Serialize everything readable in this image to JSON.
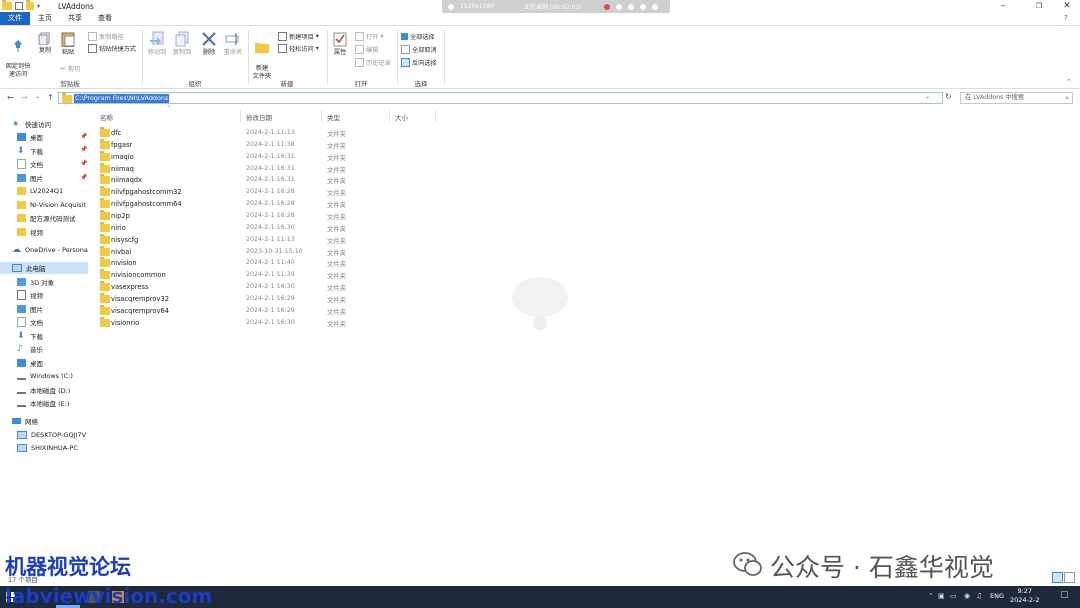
{
  "window": {
    "title": "LVAddons",
    "controls": [
      "minimize-icon",
      "maximize-icon",
      "close-icon"
    ],
    "help": "?"
  },
  "recorder": {
    "resolution": "1920x1080",
    "status": "正在录制 [00:02:03]"
  },
  "tabs": [
    {
      "label": "文件",
      "active": true
    },
    {
      "label": "主页"
    },
    {
      "label": "共享"
    },
    {
      "label": "查看"
    }
  ],
  "ribbon": {
    "clipboard": {
      "label": "剪贴板",
      "pin": "固定到快\n速访问",
      "copy": "复制",
      "paste": "粘贴",
      "copy_path": "复制路径",
      "paste_shortcut": "粘贴快捷方式",
      "cut": "剪切"
    },
    "organize": {
      "label": "组织",
      "move_to": "移动到",
      "copy_to": "复制到",
      "delete": "删除",
      "rename": "重命名"
    },
    "new": {
      "label": "新建",
      "new_folder": "新建\n文件夹",
      "new_item": "新建项目",
      "easy_access": "轻松访问"
    },
    "open": {
      "label": "打开",
      "properties": "属性",
      "open": "打开",
      "edit": "编辑",
      "history": "历史记录"
    },
    "select": {
      "label": "选择",
      "select_all": "全部选择",
      "select_none": "全部取消",
      "invert": "反向选择"
    }
  },
  "address": {
    "path": "C:\\Program Files\\NI\\LVAddons",
    "search_placeholder": "在 LVAddons 中搜索"
  },
  "sidebar": {
    "items": [
      {
        "label": "快速访问",
        "icon": "star-icon",
        "color": "#3a8de0"
      },
      {
        "label": "桌面",
        "icon": "desktop-icon",
        "color": "#3a8de0",
        "pinned": true
      },
      {
        "label": "下载",
        "icon": "download-icon",
        "color": "#3a8de0",
        "pinned": true
      },
      {
        "label": "文档",
        "icon": "document-icon",
        "color": "#9aa",
        "pinned": true
      },
      {
        "label": "图片",
        "icon": "picture-icon",
        "color": "#4a9ad8",
        "pinned": true
      },
      {
        "label": "LV2024Q1",
        "icon": "folder-icon",
        "color": "#f5c842"
      },
      {
        "label": "NI-Vision Acquisit",
        "icon": "folder-icon",
        "color": "#f5c842"
      },
      {
        "label": "配方源代码测试",
        "icon": "folder-icon",
        "color": "#f5c842"
      },
      {
        "label": "视频",
        "icon": "folder-icon",
        "color": "#f5c842"
      },
      {
        "label": "OneDrive - Persona",
        "icon": "cloud-icon",
        "color": "#2f7fd6"
      },
      {
        "label": "此电脑",
        "icon": "computer-icon",
        "color": "#3a8de0",
        "selected": true
      },
      {
        "label": "3D 对象",
        "icon": "cube-icon",
        "color": "#4aa0e0"
      },
      {
        "label": "视频",
        "icon": "video-icon",
        "color": "#777"
      },
      {
        "label": "图片",
        "icon": "picture-icon",
        "color": "#4a9ad8"
      },
      {
        "label": "文档",
        "icon": "document-icon",
        "color": "#9aa"
      },
      {
        "label": "下载",
        "icon": "download-icon",
        "color": "#3a8de0"
      },
      {
        "label": "音乐",
        "icon": "music-icon",
        "color": "#3a8de0"
      },
      {
        "label": "桌面",
        "icon": "desktop-icon",
        "color": "#3a8de0"
      },
      {
        "label": "Windows (C:)",
        "icon": "drive-icon",
        "color": "#777"
      },
      {
        "label": "本地磁盘 (D:)",
        "icon": "drive-icon",
        "color": "#777"
      },
      {
        "label": "本地磁盘 (E:)",
        "icon": "drive-icon",
        "color": "#777"
      },
      {
        "label": "网络",
        "icon": "network-icon",
        "color": "#3a8de0"
      },
      {
        "label": "DESKTOP-GQJI7V",
        "icon": "computer-icon",
        "color": "#3a8de0"
      },
      {
        "label": "SHIXINHUA-PC",
        "icon": "computer-icon",
        "color": "#3a8de0"
      }
    ]
  },
  "columns": {
    "name": "名称",
    "modified": "修改日期",
    "type": "类型",
    "size": "大小"
  },
  "files": [
    {
      "name": "dfc",
      "date": "2024-2-1 11:13",
      "type": "文件夹"
    },
    {
      "name": "fpgasr",
      "date": "2024-2-1 11:38",
      "type": "文件夹"
    },
    {
      "name": "imaqio",
      "date": "2024-2-1 16:31",
      "type": "文件夹"
    },
    {
      "name": "niimaq",
      "date": "2024-2-1 16:31",
      "type": "文件夹"
    },
    {
      "name": "niimaqdx",
      "date": "2024-2-1 16:31",
      "type": "文件夹"
    },
    {
      "name": "nilvfpgahostcomm32",
      "date": "2024-2-1 16:28",
      "type": "文件夹"
    },
    {
      "name": "nilvfpgahostcomm64",
      "date": "2024-2-1 16:28",
      "type": "文件夹"
    },
    {
      "name": "nip2p",
      "date": "2024-2-1 16:28",
      "type": "文件夹"
    },
    {
      "name": "nirio",
      "date": "2024-2-1 16:30",
      "type": "文件夹"
    },
    {
      "name": "nisyscfg",
      "date": "2024-2-1 11:13",
      "type": "文件夹"
    },
    {
      "name": "nivbai",
      "date": "2023-10-31 15:10",
      "type": "文件夹"
    },
    {
      "name": "nivision",
      "date": "2024-2-1 11:40",
      "type": "文件夹"
    },
    {
      "name": "nivisioncommon",
      "date": "2024-2-1 11:39",
      "type": "文件夹"
    },
    {
      "name": "vasexpress",
      "date": "2024-2-1 16:30",
      "type": "文件夹"
    },
    {
      "name": "visacqremprov32",
      "date": "2024-2-1 16:29",
      "type": "文件夹"
    },
    {
      "name": "visacqremprov64",
      "date": "2024-2-1 16:29",
      "type": "文件夹"
    },
    {
      "name": "visionrio",
      "date": "2024-2-1 16:30",
      "type": "文件夹"
    }
  ],
  "status": {
    "count": "17 个项目"
  },
  "watermarks": {
    "top": "机器视觉论坛",
    "bottom": "labviewvision.com",
    "wechat": "公众号 · 石鑫华视觉"
  },
  "tray": {
    "lang": "ENG",
    "time": "9:27",
    "date": "2024-2-2"
  }
}
